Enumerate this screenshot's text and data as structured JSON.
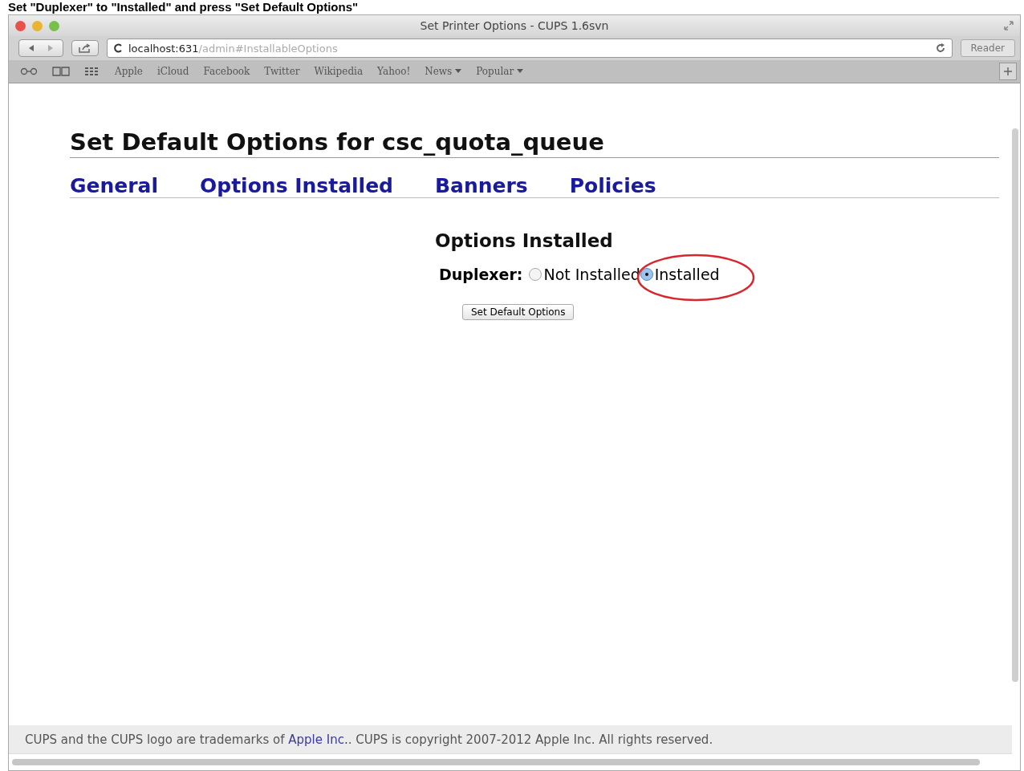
{
  "caption": "Set \"Duplexer\" to \"Installed\" and press \"Set Default Options\"",
  "window": {
    "title": "Set Printer Options - CUPS 1.6svn"
  },
  "toolbar": {
    "url_host": "localhost:631",
    "url_path": "/admin#InstallableOptions",
    "reader_label": "Reader"
  },
  "bookmarks": [
    {
      "label": "Apple",
      "kind": "link"
    },
    {
      "label": "iCloud",
      "kind": "link"
    },
    {
      "label": "Facebook",
      "kind": "link"
    },
    {
      "label": "Twitter",
      "kind": "link"
    },
    {
      "label": "Wikipedia",
      "kind": "link"
    },
    {
      "label": "Yahoo!",
      "kind": "link"
    },
    {
      "label": "News",
      "kind": "menu"
    },
    {
      "label": "Popular",
      "kind": "menu"
    }
  ],
  "page": {
    "heading": "Set Default Options for csc_quota_queue",
    "tabs": [
      {
        "label": "General"
      },
      {
        "label": "Options Installed"
      },
      {
        "label": "Banners"
      },
      {
        "label": "Policies"
      }
    ],
    "section_heading": "Options Installed",
    "field_label": "Duplexer:",
    "options": [
      {
        "label": "Not Installed",
        "selected": false,
        "highlighted": false
      },
      {
        "label": "Installed",
        "selected": true,
        "highlighted": true
      }
    ],
    "submit_label": "Set Default Options"
  },
  "footer": {
    "before": "CUPS and the CUPS logo are trademarks of",
    "link": "Apple Inc.",
    "after": ". CUPS is copyright 2007-2012 Apple Inc. All rights reserved."
  }
}
